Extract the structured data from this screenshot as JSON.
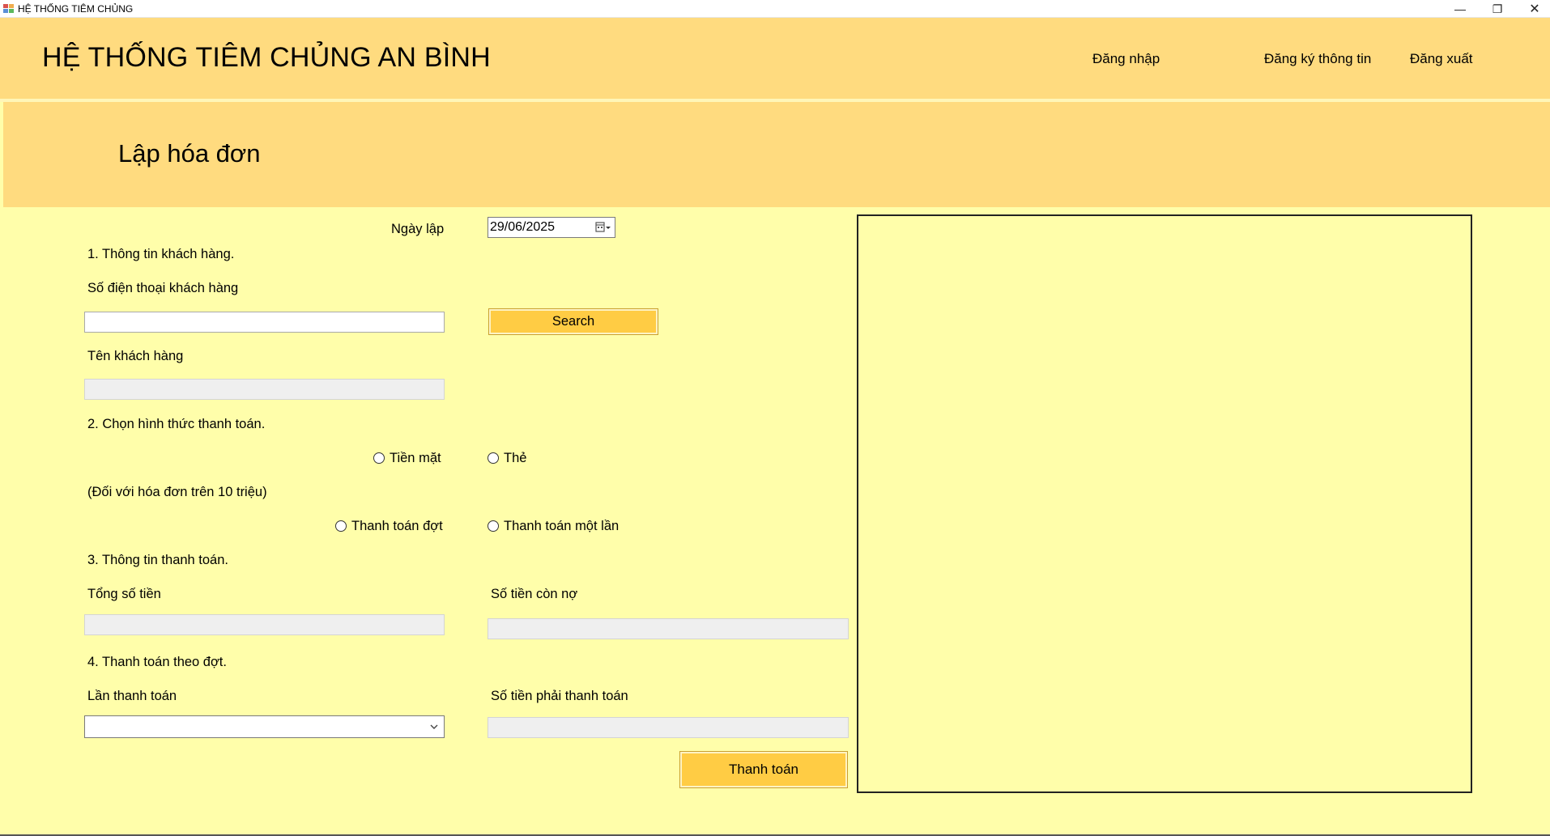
{
  "window": {
    "title": "HỆ THỐNG TIÊM CHỦNG",
    "controls": {
      "minimize": "—",
      "maximize": "❐",
      "close": "✕"
    }
  },
  "header": {
    "app_title": "HỆ THỐNG TIÊM CHỦNG AN BÌNH",
    "nav": {
      "login": "Đăng nhập",
      "register": "Đăng ký thông tin",
      "logout": "Đăng xuất"
    }
  },
  "page": {
    "title": "Lập hóa đơn"
  },
  "form": {
    "date_label": "Ngày lập",
    "date_value": "29/06/2025",
    "section1": "1. Thông tin khách hàng.",
    "phone_label": "Số điện thoại khách hàng",
    "phone_value": "",
    "search_label": "Search",
    "customer_name_label": "Tên khách hàng",
    "customer_name_value": "",
    "section2": "2. Chọn hình thức thanh toán.",
    "pay_method_options": [
      "Tiền mặt",
      "Thẻ"
    ],
    "over_limit_note": "(Đối với hóa đơn trên 10 triệu)",
    "installment_options": [
      "Thanh toán đợt",
      "Thanh toán một lần"
    ],
    "section3": "3. Thông tin thanh toán.",
    "total_label": "Tổng số tiền",
    "total_value": "",
    "debt_label": "Số tiền còn nợ",
    "debt_value": "",
    "section4": "4. Thanh toán theo đợt.",
    "installment_no_label": "Lần thanh toán",
    "installment_no_value": "",
    "amount_due_label": "Số tiền phải thanh toán",
    "amount_due_value": "",
    "pay_button_label": "Thanh toán"
  },
  "colors": {
    "header_bg": "#ffdb7f",
    "body_bg": "#fffeaa",
    "button_bg": "#ffcc44"
  }
}
